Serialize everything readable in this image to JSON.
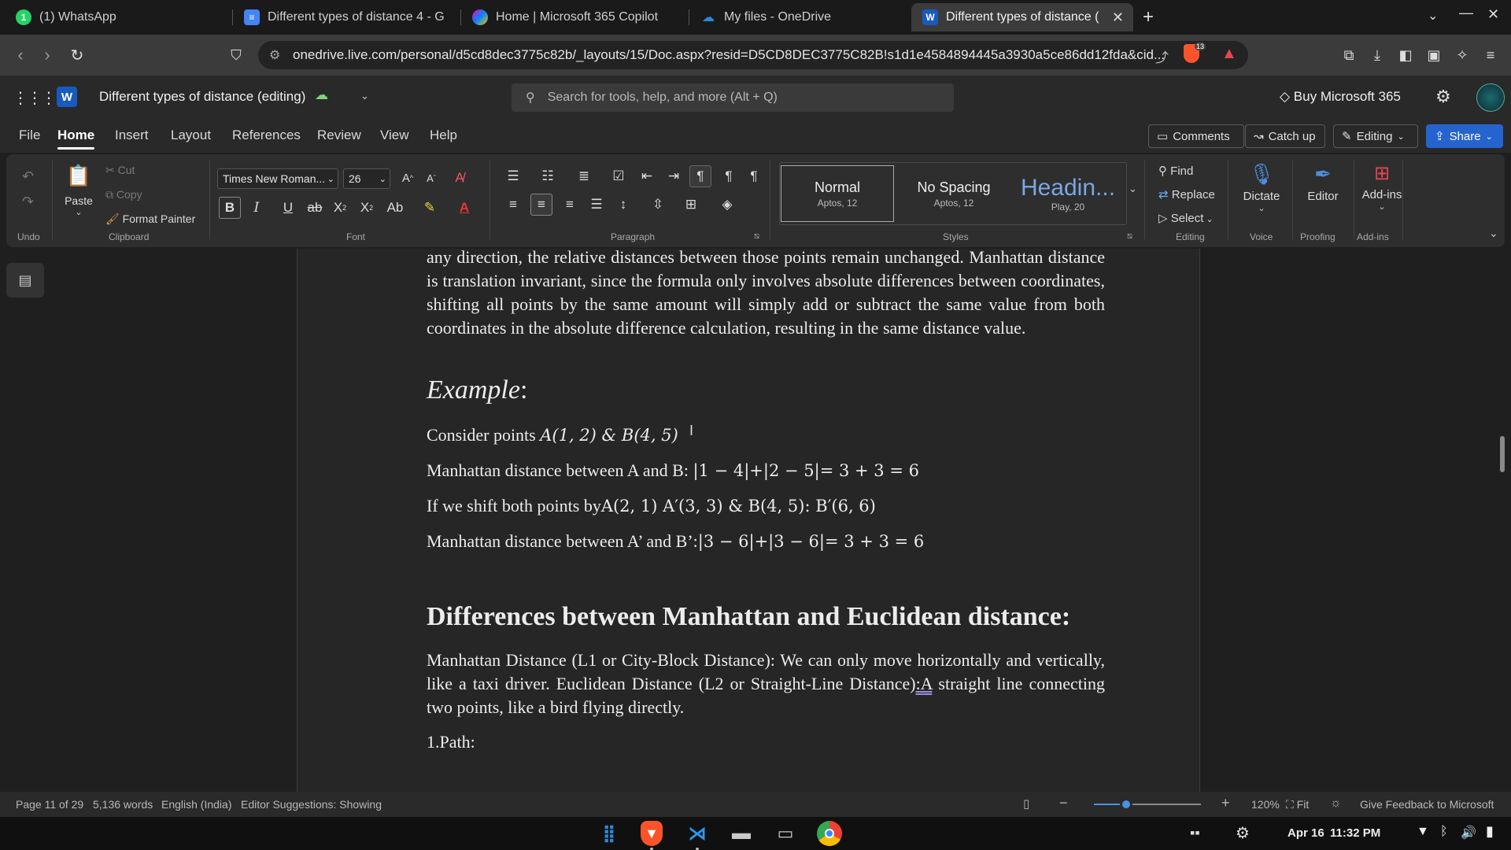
{
  "browser": {
    "tabs": [
      {
        "title": "(1) WhatsApp",
        "icon": "whatsapp-icon"
      },
      {
        "title": "Different types of distance 4 - G",
        "icon": "google-docs-icon"
      },
      {
        "title": "Home | Microsoft 365 Copilot",
        "icon": "copilot-icon"
      },
      {
        "title": "My files - OneDrive",
        "icon": "onedrive-icon"
      },
      {
        "title": "Different types of distance (",
        "icon": "word-icon"
      }
    ],
    "url": "onedrive.live.com/personal/d5cd8dec3775c82b/_layouts/15/Doc.aspx?resid=D5CD8DEC3775C82B!s1d1e4584894445a3930a5ce86dd12fda&cid...",
    "brave_badge": "13"
  },
  "app": {
    "doc_title": "Different types of distance (editing)",
    "search_placeholder": "Search for tools, help, and more (Alt + Q)",
    "buy_label": "Buy Microsoft 365",
    "word_logo": "W"
  },
  "menu": {
    "items": [
      "File",
      "Home",
      "Insert",
      "Layout",
      "References",
      "Review",
      "View",
      "Help"
    ],
    "comments": "Comments",
    "catch_up": "Catch up",
    "editing": "Editing",
    "share": "Share"
  },
  "ribbon": {
    "undo_group": "Undo",
    "paste": "Paste",
    "cut": "Cut",
    "copy": "Copy",
    "format_painter": "Format Painter",
    "clipboard_group": "Clipboard",
    "font_name": "Times New Roman...",
    "font_size": "26",
    "font_group": "Font",
    "paragraph_group": "Paragraph",
    "styles": [
      {
        "name": "Normal",
        "sub": "Aptos, 12"
      },
      {
        "name": "No Spacing",
        "sub": "Aptos, 12"
      },
      {
        "name": "Headin...",
        "sub": "Play, 20"
      }
    ],
    "styles_group": "Styles",
    "find": "Find",
    "replace": "Replace",
    "select": "Select",
    "editing_group": "Editing",
    "dictate": "Dictate",
    "voice_group": "Voice",
    "editor": "Editor",
    "proofing_group": "Proofing",
    "addins": "Add-ins",
    "addins_group": "Add-ins"
  },
  "document": {
    "para1": "any direction, the relative distances between those points remain unchanged. Manhattan distance is translation invariant, since the formula only involves absolute differences between coordinates, shifting all points by the same amount will simply add or subtract the same value from both coordinates in the absolute difference calculation, resulting in the same distance value.",
    "example_heading": "Example",
    "example_colon": ":",
    "line1_text": "Consider points ",
    "line1_math": "A(1, 2) & B(4, 5)",
    "line2_text": "Manhattan distance between A and B: ",
    "line2_math": "|1 − 4|+|2 − 5|= 3 + 3 = 6",
    "line3_text": "If we shift both points by",
    "line3_math": "A(2, 1)  A′(3, 3) & B(4, 5):  B′(6, 6)",
    "line4_text": "Manhattan distance between A’ and B’:",
    "line4_math": "|3 − 6|+|3 − 6|= 3 + 3 = 6",
    "heading2": "Differences between Manhattan and Euclidean distance:",
    "para2_a": "Manhattan Distance (L1 or City-Block Distance): We can only move horizontally and vertically, like a taxi driver. Euclidean Distance (L2 or Straight-Line Distance)",
    "para2_link": ":A",
    "para2_b": " straight line connecting two points, like a bird flying directly.",
    "path_label": "1.Path:"
  },
  "status": {
    "page": "Page 11 of 29",
    "words": "5,136 words",
    "language": "English (India)",
    "editor": "Editor Suggestions: Showing",
    "zoom": "120%",
    "fit": "Fit",
    "feedback": "Give Feedback to Microsoft",
    "zoom_level": 0.3
  },
  "taskbar": {
    "date": "Apr 16",
    "time": "11:32 PM"
  },
  "colors": {
    "share_bg": "#2564cf",
    "word_blue": "#185abd",
    "accent_red": "#e5484d"
  }
}
